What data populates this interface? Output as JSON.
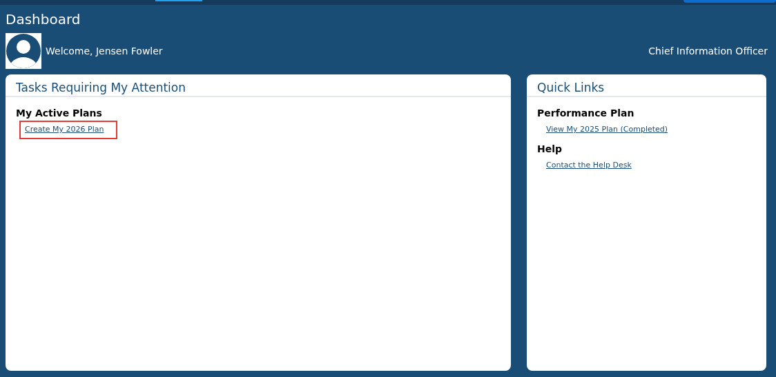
{
  "page": {
    "title": "Dashboard"
  },
  "user": {
    "welcome": "Welcome, Jensen Fowler",
    "role": "Chief Information Officer"
  },
  "panels": [
    {
      "title": "Tasks Requiring My Attention",
      "sections": [
        {
          "heading": "My Active Plans",
          "links": [
            {
              "label": "Create My 2026 Plan",
              "highlighted": true
            }
          ]
        }
      ]
    },
    {
      "title": "Quick Links",
      "sections": [
        {
          "heading": "Performance Plan",
          "links": [
            {
              "label": "View My 2025 Plan (Completed)",
              "highlighted": false
            }
          ]
        },
        {
          "heading": "Help",
          "links": [
            {
              "label": "Contact the Help Desk",
              "highlighted": false
            }
          ]
        }
      ]
    }
  ]
}
